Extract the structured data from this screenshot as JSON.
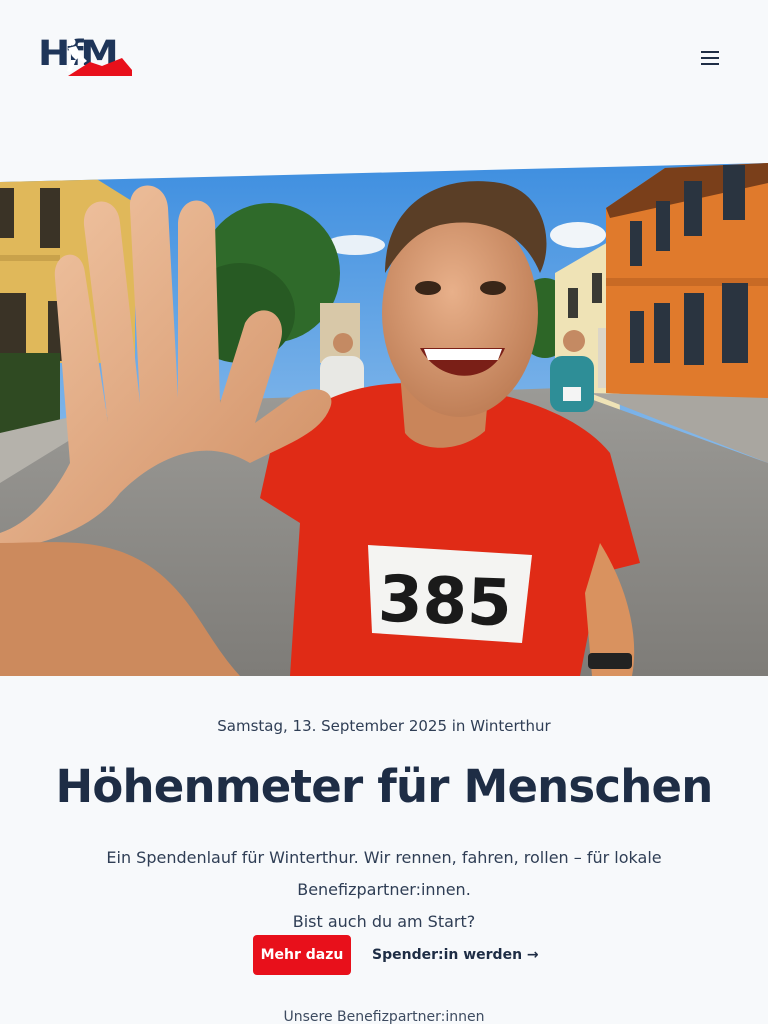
{
  "header": {
    "logo_text": "HfM",
    "menu_icon": "hamburger-menu-icon",
    "brand_color": "#1e3559",
    "accent_color": "#e8101b"
  },
  "hero": {
    "bib_number": "385"
  },
  "main": {
    "subtitle": "Samstag, 13. September 2025 in Winterthur",
    "title": "Höhenmeter für Menschen",
    "intro_line1": "Ein Spendenlauf für Winterthur. Wir rennen, fahren, rollen – für lokale Benefizpartner:innen.",
    "intro_line2": "Bist auch du am Start?",
    "cta_primary": "Mehr dazu",
    "cta_secondary": "Spender:in werden →",
    "partners_label": "Unsere Benefizpartner:innen"
  }
}
